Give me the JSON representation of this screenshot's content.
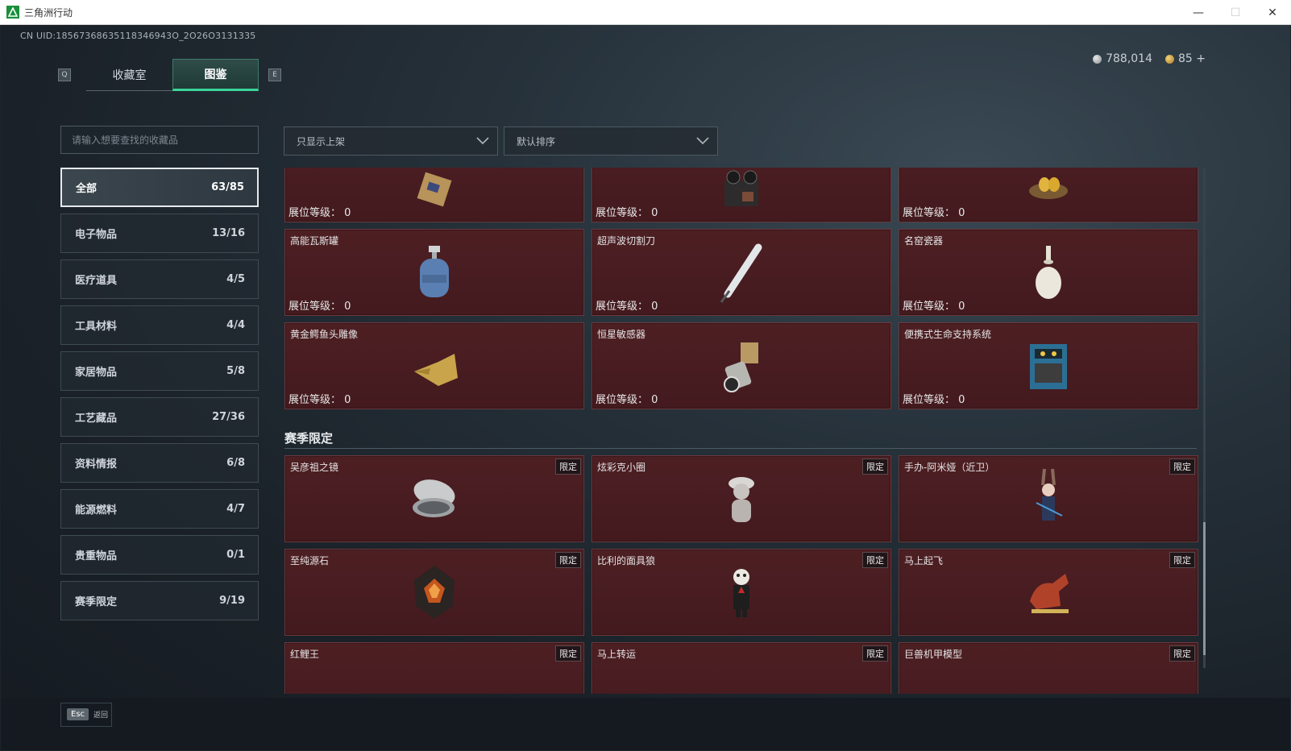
{
  "window": {
    "title": "三角洲行动"
  },
  "uid": "CN UID:18567368635118346943O_2O26O3131335",
  "currency": {
    "silver": "788,014",
    "gold": "85 +"
  },
  "keys": {
    "left": "Q",
    "right": "E",
    "esc": "Esc",
    "back": "返回"
  },
  "tabs": [
    {
      "label": "收藏室"
    },
    {
      "label": "图鉴"
    }
  ],
  "search": {
    "placeholder": "请输入想要查找的收藏品"
  },
  "filters": {
    "display": "只显示上架",
    "sort": "默认排序"
  },
  "categories": [
    {
      "label": "全部",
      "count": "63/85"
    },
    {
      "label": "电子物品",
      "count": "13/16"
    },
    {
      "label": "医疗道具",
      "count": "4/5"
    },
    {
      "label": "工具材料",
      "count": "4/4"
    },
    {
      "label": "家居物品",
      "count": "5/8"
    },
    {
      "label": "工艺藏品",
      "count": "27/36"
    },
    {
      "label": "资料情报",
      "count": "6/8"
    },
    {
      "label": "能源燃料",
      "count": "4/7"
    },
    {
      "label": "贵重物品",
      "count": "0/1"
    },
    {
      "label": "赛季限定",
      "count": "9/19"
    }
  ],
  "level_label": "展位等级：",
  "level_value": "0",
  "top_rows": [
    [
      {
        "name": "",
        "icon": "gold-device-icon",
        "level": "展位等级：  0"
      },
      {
        "name": "",
        "icon": "tape-recorder-icon",
        "level": "展位等级：  0"
      },
      {
        "name": "",
        "icon": "golden-eggs-nest-icon",
        "level": "展位等级：  0"
      }
    ],
    [
      {
        "name": "高能瓦斯罐",
        "icon": "gas-tank-icon",
        "level": "展位等级：  0"
      },
      {
        "name": "超声波切割刀",
        "icon": "ultrasonic-cutter-icon",
        "level": "展位等级：  0"
      },
      {
        "name": "名窑瓷器",
        "icon": "porcelain-vase-icon",
        "level": "展位等级：  0"
      }
    ],
    [
      {
        "name": "黄金鳄鱼头雕像",
        "icon": "gold-crocodile-icon",
        "level": "展位等级：  0"
      },
      {
        "name": "恒星敏感器",
        "icon": "star-sensor-icon",
        "level": "展位等级：  0"
      },
      {
        "name": "便携式生命支持系统",
        "icon": "life-support-icon",
        "level": "展位等级：  0"
      }
    ]
  ],
  "season_section": {
    "title": "赛季限定"
  },
  "limited_badge": "限定",
  "season_rows": [
    [
      {
        "name": "吴彦祖之镜",
        "icon": "compact-mirror-icon"
      },
      {
        "name": "炫彩克小圈",
        "icon": "figure-icon"
      },
      {
        "name": "手办-阿米娅（近卫）",
        "icon": "amiya-figure-icon"
      }
    ],
    [
      {
        "name": "至纯源石",
        "icon": "originium-icon"
      },
      {
        "name": "比利的面具狼",
        "icon": "billy-puppet-icon"
      },
      {
        "name": "马上起飞",
        "icon": "red-horse-icon"
      }
    ],
    [
      {
        "name": "红鲤王",
        "icon": "red-koi-icon"
      },
      {
        "name": "马上转运",
        "icon": "gold-horse-icon"
      },
      {
        "name": "巨兽机甲模型",
        "icon": "mech-model-icon"
      }
    ]
  ],
  "colors": {
    "accent": "#39d59a",
    "card_bg": "#4a1d21",
    "panel": "#222a31"
  }
}
